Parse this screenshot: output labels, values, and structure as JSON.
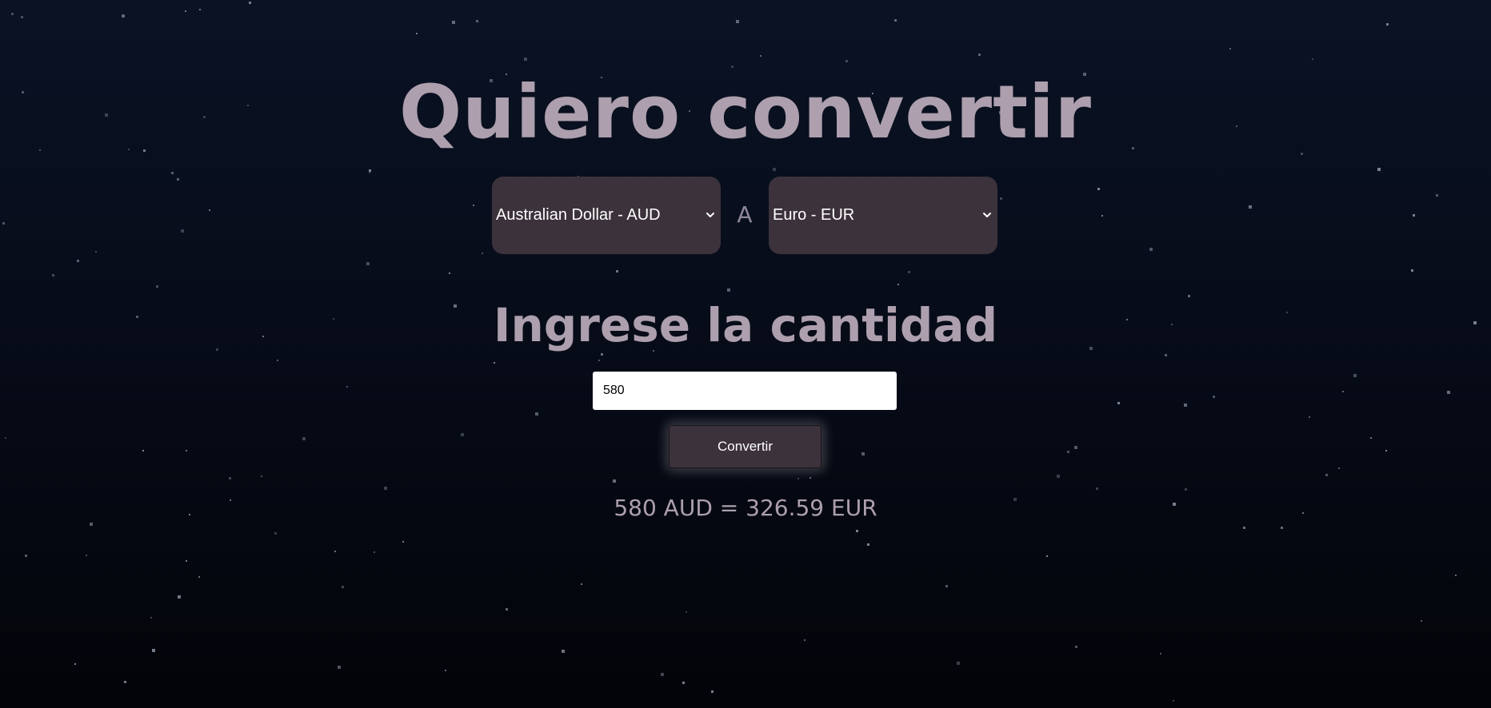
{
  "colors": {
    "background_top": "#0a1224",
    "background_bottom": "#030409",
    "heading_text": "#ad9fad",
    "select_background": "#3c323b",
    "button_background": "#3c323b"
  },
  "header": {
    "title": "Quiero convertir"
  },
  "converter": {
    "from_currency": "Australian Dollar - AUD",
    "separator": "A",
    "to_currency": "Euro - EUR",
    "amount_heading": "Ingrese la cantidad",
    "amount_value": "580",
    "convert_label": "Convertir",
    "result": "580 AUD = 326.59 EUR"
  },
  "icons": {
    "select_arrow": "chevron-down-icon"
  }
}
